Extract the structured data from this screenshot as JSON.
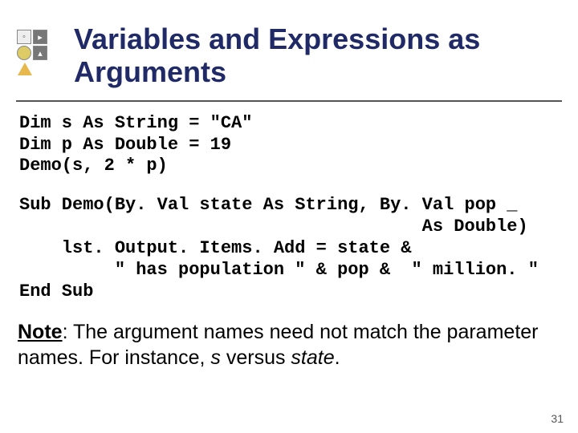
{
  "title_line1": "Variables and Expressions as",
  "title_line2": "Arguments",
  "code_block1_line1": "Dim s As String = \"CA\"",
  "code_block1_line2": "Dim p As Double = 19",
  "code_block1_line3": "Demo(s, 2 * p)",
  "code_block2_line1": "Sub Demo(By. Val state As String, By. Val pop _",
  "code_block2_line2": "                                      As Double)",
  "code_block2_line3": "    lst. Output. Items. Add = state &",
  "code_block2_line4": "         \" has population \" & pop &  \" million. \"",
  "code_block2_line5": "End Sub",
  "note_lead": "Note",
  "note_rest1": ": The argument names need not match the parameter names. For instance, ",
  "note_em1": "s",
  "note_mid": " versus ",
  "note_em2": "state",
  "note_end": ".",
  "page_number": "31"
}
